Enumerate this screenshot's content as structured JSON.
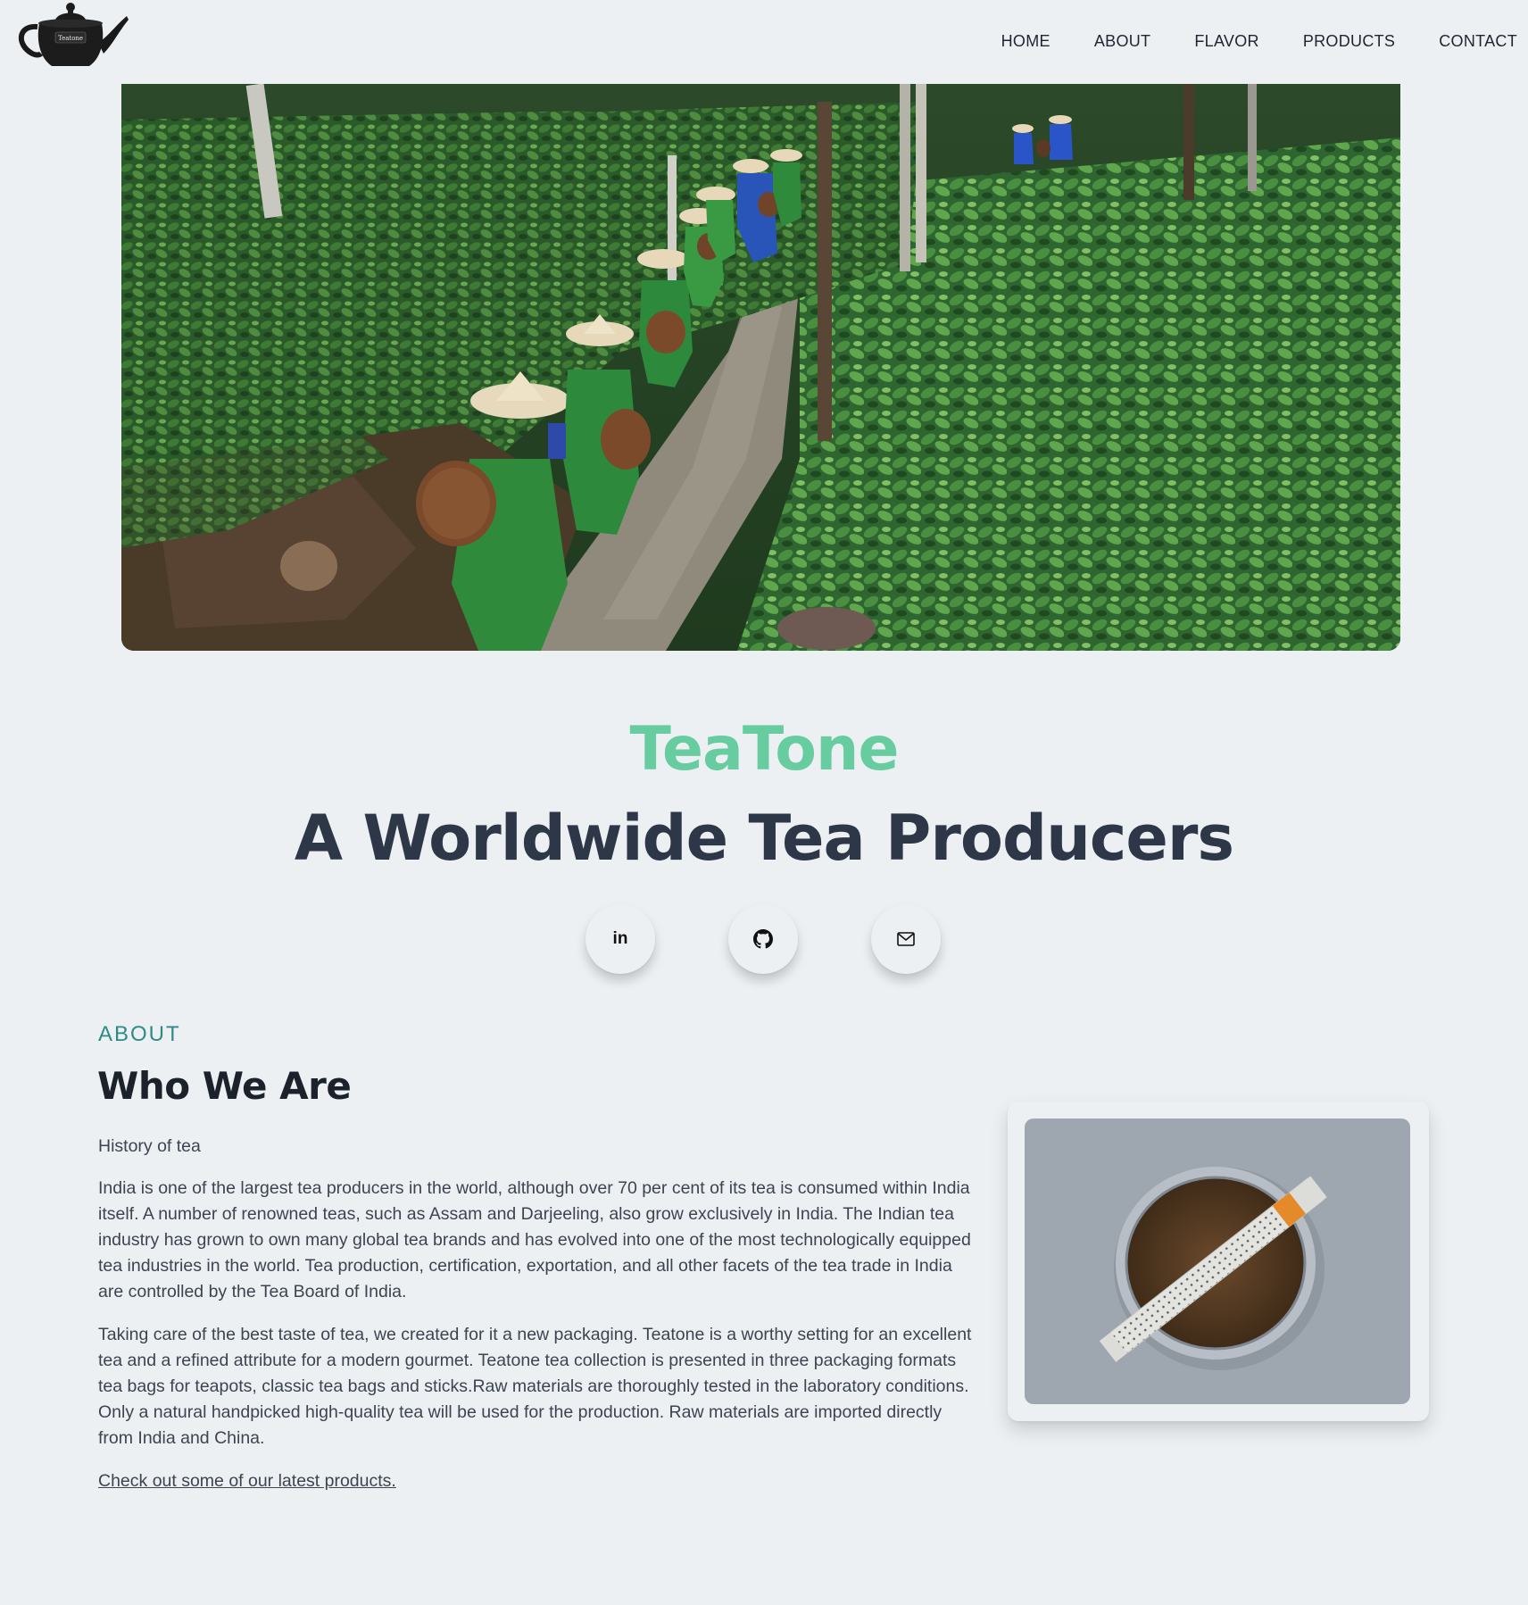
{
  "header": {
    "logo_text": "Teatone",
    "nav": [
      "HOME",
      "ABOUT",
      "FLAVOR",
      "PRODUCTS",
      "CONTACT"
    ]
  },
  "hero": {
    "brand": "TeaTone",
    "tagline": "A Worldwide Tea Producers"
  },
  "socials": [
    "linkedin-icon",
    "github-icon",
    "mail-icon"
  ],
  "about": {
    "label": "ABOUT",
    "title": "Who We Are",
    "history": "History of tea",
    "paragraph1": "India is one of the largest tea producers in the world, although over 70 per cent of its tea is consumed within India itself. A number of renowned teas, such as Assam and Darjeeling, also grow exclusively in India. The Indian tea industry has grown to own many global tea brands and has evolved into one of the most technologically equipped tea industries in the world. Tea production, certification, exportation, and all other facets of the tea trade in India are controlled by the Tea Board of India.",
    "paragraph2": "Taking care of the best taste of tea, we created for it a new packaging. Teatone is a worthy setting for an excellent tea and a refined attribute for a modern gourmet. Teatone tea collection is presented in three packaging formats tea bags for teapots, classic tea bags and sticks.Raw materials are thoroughly tested in the laboratory conditions. Only a natural handpicked high-quality tea will be used for the production. Raw materials are imported directly from India and China.",
    "link": "Check out some of our latest products."
  },
  "colors": {
    "background": "#edf0f3",
    "brand_green": "#67cc9f",
    "about_teal": "#2d8a84",
    "heading_dark": "#2d3748"
  }
}
